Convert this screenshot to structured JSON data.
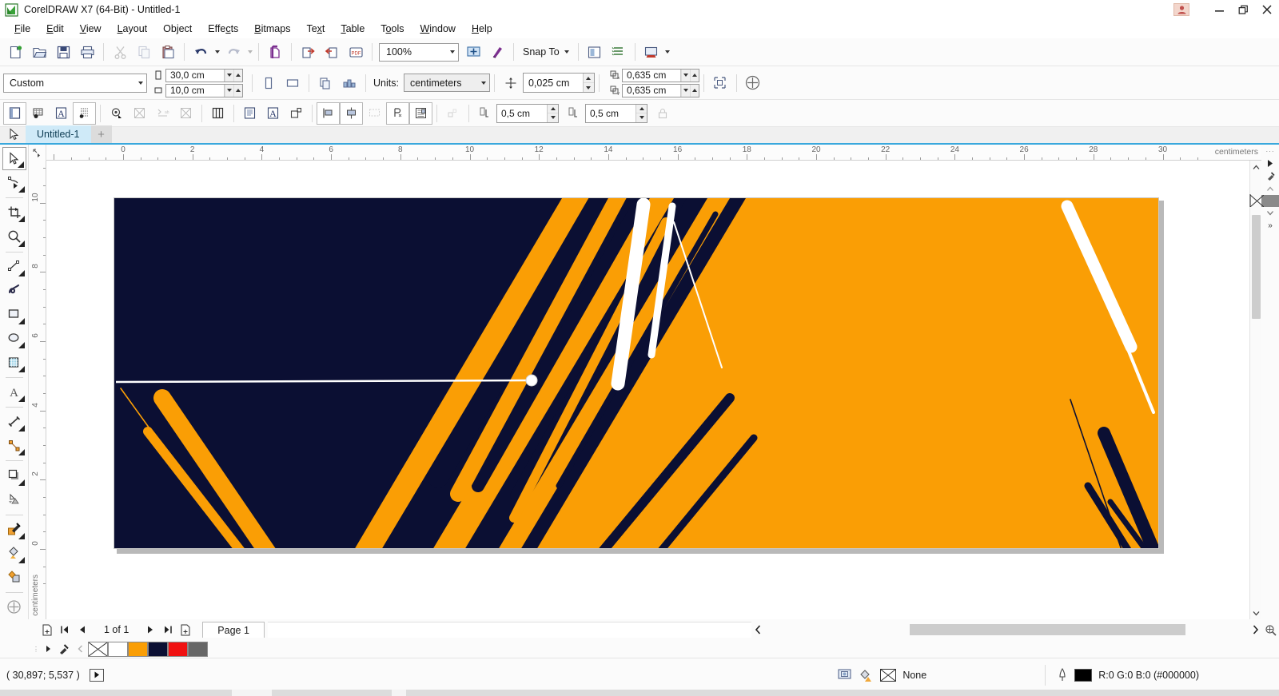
{
  "window": {
    "title": "CorelDRAW X7 (64-Bit) - Untitled-1",
    "logo_icon": "coreldraw-logo",
    "user_icon": "user-account-icon",
    "minimize_label": "—",
    "restore_label": "❐",
    "close_label": "✕"
  },
  "menubar": {
    "items": [
      {
        "label": "File",
        "mnemonic": "F"
      },
      {
        "label": "Edit",
        "mnemonic": "E"
      },
      {
        "label": "View",
        "mnemonic": "V"
      },
      {
        "label": "Layout",
        "mnemonic": "L"
      },
      {
        "label": "Object",
        "mnemonic": "O"
      },
      {
        "label": "Effects",
        "mnemonic": "c"
      },
      {
        "label": "Bitmaps",
        "mnemonic": "B"
      },
      {
        "label": "Text",
        "mnemonic": "x"
      },
      {
        "label": "Table",
        "mnemonic": "T"
      },
      {
        "label": "Tools",
        "mnemonic": "o"
      },
      {
        "label": "Window",
        "mnemonic": "W"
      },
      {
        "label": "Help",
        "mnemonic": "H"
      }
    ]
  },
  "standard_toolbar": {
    "buttons": [
      {
        "name": "new-document-button",
        "tip": "New"
      },
      {
        "name": "open-document-button",
        "tip": "Open"
      },
      {
        "name": "save-document-button",
        "tip": "Save"
      },
      {
        "name": "print-button",
        "tip": "Print"
      },
      {
        "name": "cut-button",
        "tip": "Cut",
        "disabled": true
      },
      {
        "name": "copy-button",
        "tip": "Copy",
        "disabled": true
      },
      {
        "name": "paste-button",
        "tip": "Paste"
      },
      {
        "name": "undo-button",
        "tip": "Undo"
      },
      {
        "name": "redo-button",
        "tip": "Redo",
        "disabled": true
      },
      {
        "name": "import-button",
        "tip": "Import"
      },
      {
        "name": "export-button",
        "tip": "Export"
      },
      {
        "name": "publish-pdf-button",
        "tip": "Publish to PDF"
      }
    ],
    "zoom_level": "100%",
    "zoom_dropdown_icon": "chevron-down-icon",
    "fullscreen_button": "full-screen-preview",
    "launch_button": "application-launcher",
    "snap_to_label": "Snap To",
    "snap_to_icon": "chevron-down-icon",
    "options_button": "options-icon",
    "object_manager_button": "object-manager-icon",
    "import_dropdown_button": "import-dropdown-icon"
  },
  "page_toolbar": {
    "page_preset": "Custom",
    "preset_dropdown_icon": "chevron-down-icon",
    "page_width": "30,0 cm",
    "page_height": "10,0 cm",
    "width_icon": "page-width-icon",
    "height_icon": "page-height-icon",
    "portrait_button": "portrait-orientation-icon",
    "landscape_button": "landscape-orientation-icon",
    "all_pages_button": "all-pages-icon",
    "current_page_button": "current-page-only-icon",
    "units_label": "Units:",
    "units_value": "centimeters",
    "units_dropdown_icon": "chevron-down-icon",
    "nudge_icon": "nudge-offset-icon",
    "nudge_value": "0,025 cm",
    "duplicate_x_icon": "duplicate-distance-x-icon",
    "duplicate_x_value": "0,635 cm",
    "duplicate_y_icon": "duplicate-distance-y-icon",
    "duplicate_y_value": "0,635 cm",
    "edit_scale_button": "drawing-scale-icon",
    "add_page_frame_button": "page-frame-add-icon"
  },
  "text_toolbar": {
    "buttons": [
      {
        "name": "page-layout-icon",
        "framed": true
      },
      {
        "name": "grid-display-icon"
      },
      {
        "name": "text-display-icon"
      },
      {
        "name": "baseline-grid-icon",
        "framed": true
      },
      {
        "name": "text-options-icon"
      },
      {
        "name": "no-fill-icon",
        "disabled": true
      },
      {
        "name": "tab-settings-icon",
        "disabled": true
      },
      {
        "name": "no-outline-icon",
        "disabled": true
      },
      {
        "name": "columns-icon"
      },
      {
        "name": "paragraph-frame-icon"
      },
      {
        "name": "text-frame-icon"
      },
      {
        "name": "fit-text-frame-icon"
      },
      {
        "name": "align-left-object-icon"
      },
      {
        "name": "align-center-object-icon"
      },
      {
        "name": "distribute-icon",
        "disabled": true
      },
      {
        "name": "convert-paragraph-icon"
      },
      {
        "name": "text-wrap-icon"
      },
      {
        "name": "text-indent-icon",
        "disabled": true
      }
    ],
    "left_measure_icon": "text-wrap-offset-icon",
    "left_measure_value": "0,5 cm",
    "right_measure_icon": "text-indent-offset-icon",
    "right_measure_value": "0,5 cm",
    "lock_button": "lock-icon"
  },
  "document_tabs": {
    "picker_icon": "pick-tool-icon",
    "tabs": [
      {
        "label": "Untitled-1",
        "active": true
      }
    ],
    "add_tab_label": "+"
  },
  "toolbox": {
    "tools": [
      {
        "name": "pick-tool",
        "label": "Pick",
        "selected": true,
        "flyout": true
      },
      {
        "name": "shape-tool",
        "label": "Shape",
        "flyout": true
      },
      {
        "name": "crop-tool",
        "label": "Crop",
        "flyout": true
      },
      {
        "name": "zoom-tool",
        "label": "Zoom",
        "flyout": true
      },
      {
        "name": "freehand-tool",
        "label": "Freehand",
        "flyout": true
      },
      {
        "name": "artistic-media-tool",
        "label": "Artistic Media",
        "flyout": false
      },
      {
        "name": "rectangle-tool",
        "label": "Rectangle",
        "flyout": true
      },
      {
        "name": "ellipse-tool",
        "label": "Ellipse",
        "flyout": true
      },
      {
        "name": "polygon-tool",
        "label": "Polygon",
        "flyout": true
      },
      {
        "name": "text-tool",
        "label": "Text",
        "flyout": true
      },
      {
        "name": "parallel-dimension-tool",
        "label": "Dimension",
        "flyout": true
      },
      {
        "name": "straight-line-connector-tool",
        "label": "Connector",
        "flyout": true
      },
      {
        "name": "drop-shadow-tool",
        "label": "Drop Shadow",
        "flyout": true
      },
      {
        "name": "transparency-tool",
        "label": "Transparency",
        "flyout": false
      },
      {
        "name": "color-eyedropper-tool",
        "label": "Color Eyedropper",
        "flyout": true
      },
      {
        "name": "interactive-fill-tool",
        "label": "Interactive Fill",
        "flyout": true
      },
      {
        "name": "smart-fill-tool",
        "label": "Smart Fill",
        "flyout": false
      },
      {
        "name": "quick-customize-button",
        "label": "Quick Customize",
        "flyout": false
      }
    ]
  },
  "rulers": {
    "horizontal_unit_label": "centimeters",
    "horizontal_ticks": [
      0,
      2,
      4,
      6,
      8,
      10,
      12,
      14,
      16,
      18,
      20,
      22,
      24,
      26,
      28,
      30
    ],
    "vertical_unit_label": "centimeters",
    "vertical_ticks": [
      0,
      2,
      4,
      6,
      8,
      10
    ]
  },
  "artwork": {
    "navy": "#0b0f33",
    "orange": "#fa9e05",
    "white": "#ffffff",
    "description": "abstract diagonal stripe banner, navy left half, orange right half"
  },
  "page_navigation": {
    "add_page_start_icon": "add-page-icon",
    "first_page_icon": "first-page-icon",
    "prev_page_icon": "previous-page-icon",
    "page_counter": "1 of 1",
    "next_page_icon": "next-page-icon",
    "last_page_icon": "last-page-icon",
    "add_page_end_icon": "add-page-icon",
    "page_tab_label": "Page 1"
  },
  "scrollbars": {
    "left_arrow": "‹",
    "right_arrow": "›",
    "up_arrow": "⌃",
    "down_arrow": "⌄"
  },
  "color_strip": {
    "expand_icon": "expand-arrow-icon",
    "eyedropper_icon": "eyedropper-icon",
    "collapse_icon": "collapse-arrow-icon",
    "none_icon": "no-color-icon",
    "swatches": [
      "#ffffff",
      "#fa9e05",
      "#0b0f33",
      "#f01111",
      "#666666"
    ]
  },
  "statusbar": {
    "coordinates": "( 30,897; 5,537 )",
    "play_icon": "play-button-icon",
    "screen_icon": "color-proof-icon",
    "fill_icon": "fill-color-icon",
    "fill_none_icon": "no-fill-icon",
    "fill_value": "None",
    "outline_icon": "outline-pen-icon",
    "outline_swatch": "#000000",
    "outline_value": "R:0 G:0 B:0 (#000000)"
  },
  "palette": {
    "title_dots": "···",
    "arrow_icon": "palette-scroll-icon",
    "eyedropper_icon": "palette-eyedropper-icon",
    "up_icon": "⌃",
    "down_icon": "⌄",
    "more_icon": "»",
    "colors": [
      "none",
      "#000000",
      "#1c1c1c",
      "#333333",
      "#4c4c4c",
      "#666666",
      "#808080",
      "#999999",
      "#b3b3b3",
      "#cccccc",
      "#e6e6e6",
      "#ffffff",
      "#0000ff",
      "#00ffff",
      "#00ff00",
      "#ffff00",
      "#ff0000",
      "#ff00ff",
      "#9900cc",
      "#ff6600",
      "#ff99bb",
      "#663333",
      "#b3aee6",
      "#9d8ef0",
      "#5b8cf5",
      "#4a52e0"
    ]
  }
}
